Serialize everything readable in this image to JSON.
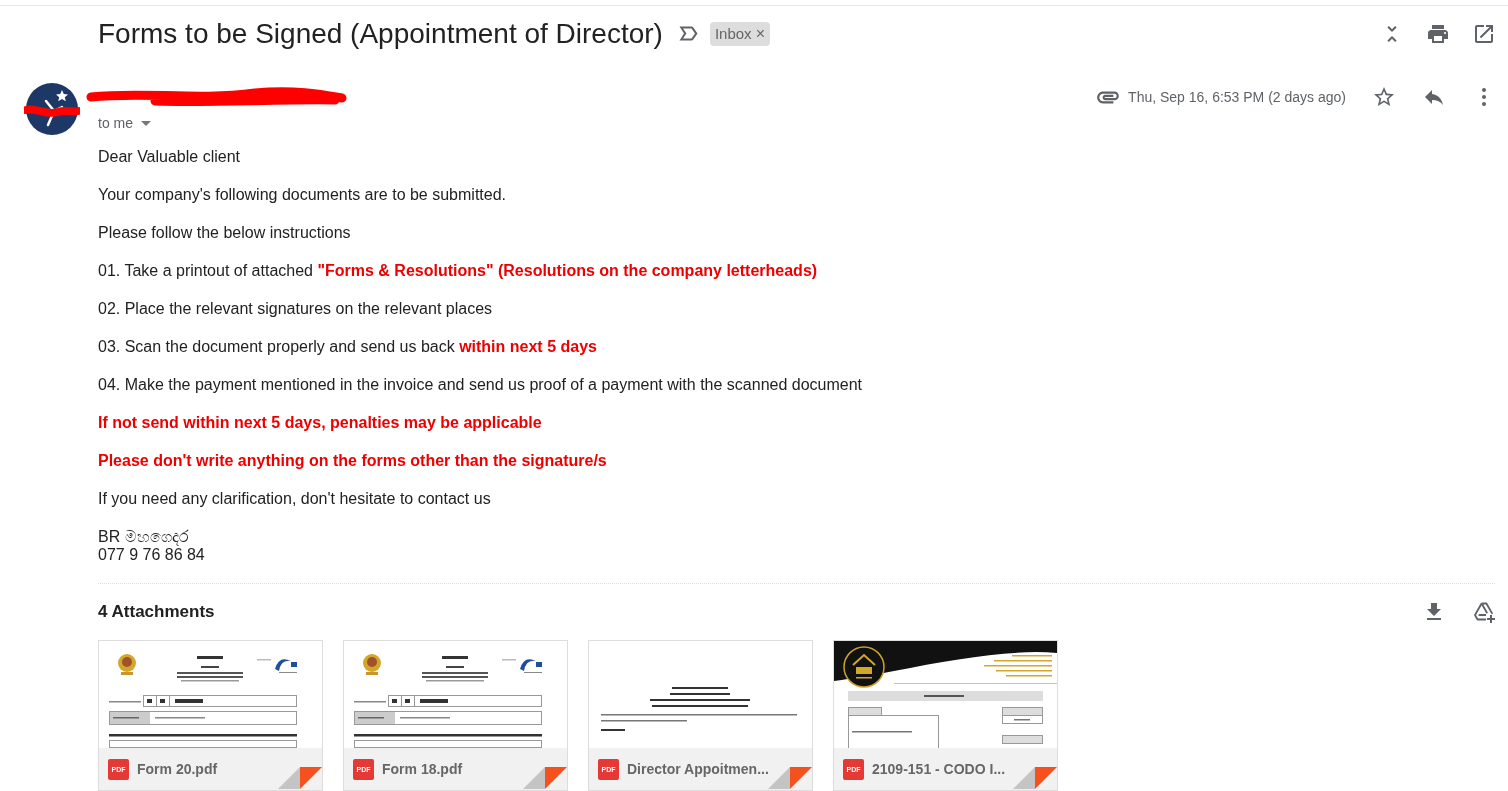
{
  "toolbar": {
    "subject": "Forms to be Signed (Appointment of Director)",
    "labels": [
      {
        "text": "Inbox",
        "remove": "×"
      }
    ]
  },
  "message": {
    "recipient": "to me",
    "date": "Thu, Sep 16, 6:53 PM (2 days ago)",
    "starred": false,
    "body": [
      {
        "kind": "text",
        "text": "Dear Valuable client"
      },
      {
        "kind": "text",
        "text": "Your company's following documents are to be submitted."
      },
      {
        "kind": "text",
        "text": "Please follow the below instructions"
      },
      {
        "kind": "text",
        "text": "01. Take a printout of attached **\"Forms & Resolutions\" (Resolutions on the company letterheads)**"
      },
      {
        "kind": "text",
        "text": "02. Place the relevant signatures on the relevant places"
      },
      {
        "kind": "text",
        "text": "03. Scan the document properly and send us back **within next 5 days**"
      },
      {
        "kind": "text",
        "text": "04. Make the payment mentioned in the invoice and send us proof of a payment with the scanned document"
      },
      {
        "kind": "warning",
        "text": "If not send within next 5 days, penalties may be applicable"
      },
      {
        "kind": "warning",
        "text": "Please don't write anything on the forms other than the signature/s"
      },
      {
        "kind": "text",
        "text": "If you need any clarification, don't hesitate to contact us"
      }
    ],
    "signature": [
      "BR මහගෙදර",
      "077 9 76 86 84"
    ]
  },
  "attachments": {
    "title": "4 Attachments",
    "files": [
      {
        "name": "Form 20.pdf",
        "type": "PDF",
        "kind": "form"
      },
      {
        "name": "Form 18.pdf",
        "type": "PDF",
        "kind": "form"
      },
      {
        "name": "Director Appoitmen...",
        "type": "PDF",
        "kind": "resolution"
      },
      {
        "name": "2109-151 - CODO I...",
        "type": "PDF",
        "kind": "invoice"
      }
    ]
  }
}
